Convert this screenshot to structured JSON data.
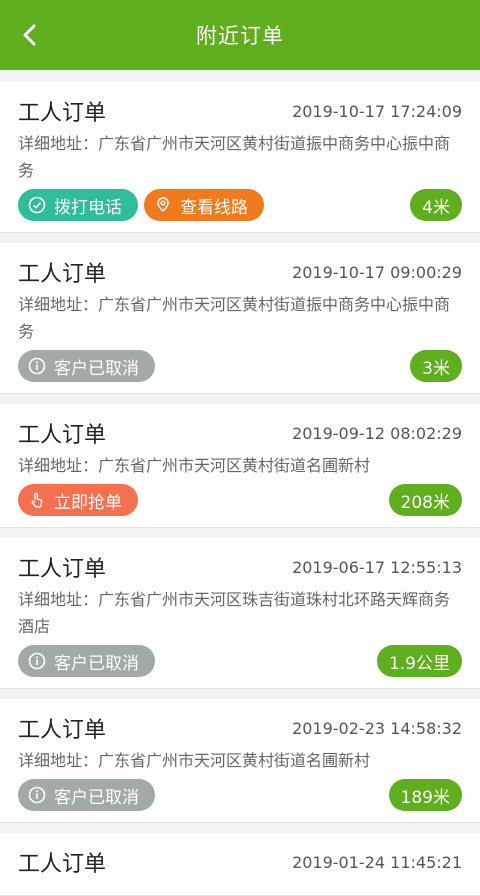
{
  "header": {
    "title": "附近订单"
  },
  "orders": [
    {
      "title": "工人订单",
      "time": "2019-10-17 17:24:09",
      "address": "详细地址：广东省广州市天河区黄村街道振中商务中心振中商务",
      "buttons": [
        {
          "label": "拨打电话",
          "color": "#2fbd9b",
          "icon": "check-circle-icon"
        },
        {
          "label": "查看线路",
          "color": "#f17a1d",
          "icon": "location-pin-icon"
        }
      ],
      "distance": "4米"
    },
    {
      "title": "工人订单",
      "time": "2019-10-17 09:00:29",
      "address": "详细地址：广东省广州市天河区黄村街道振中商务中心振中商务",
      "buttons": [
        {
          "label": "客户已取消",
          "color": "#a3a9a6",
          "icon": "info-circle-icon"
        }
      ],
      "distance": "3米"
    },
    {
      "title": "工人订单",
      "time": "2019-09-12 08:02:29",
      "address": "详细地址：广东省广州市天河区黄村街道名圃新村",
      "buttons": [
        {
          "label": "立即抢单",
          "color": "#f5704f",
          "icon": "hand-tap-icon"
        }
      ],
      "distance": "208米"
    },
    {
      "title": "工人订单",
      "time": "2019-06-17 12:55:13",
      "address": "详细地址：广东省广州市天河区珠吉街道珠村北环路天辉商务酒店",
      "buttons": [
        {
          "label": "客户已取消",
          "color": "#a3a9a6",
          "icon": "info-circle-icon"
        }
      ],
      "distance": "1.9公里"
    },
    {
      "title": "工人订单",
      "time": "2019-02-23 14:58:32",
      "address": "详细地址：广东省广州市天河区黄村街道名圃新村",
      "buttons": [
        {
          "label": "客户已取消",
          "color": "#a3a9a6",
          "icon": "info-circle-icon"
        }
      ],
      "distance": "189米"
    },
    {
      "title": "工人订单",
      "time": "2019-01-24 11:45:21",
      "address": "",
      "buttons": [],
      "distance": ""
    }
  ],
  "colors": {
    "header": "#5fae1e",
    "distance_badge": "#5fae1e"
  }
}
